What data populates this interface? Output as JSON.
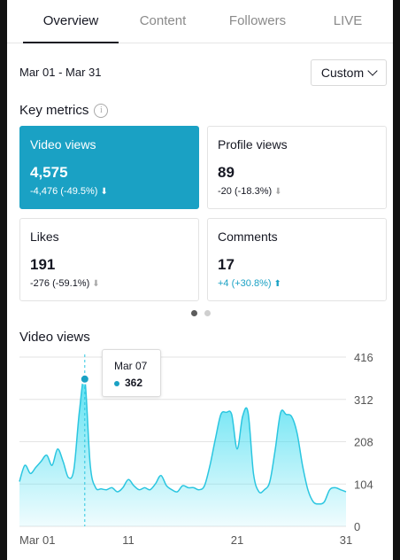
{
  "tabs": [
    {
      "label": "Overview",
      "active": true
    },
    {
      "label": "Content",
      "active": false
    },
    {
      "label": "Followers",
      "active": false
    },
    {
      "label": "LIVE",
      "active": false
    }
  ],
  "date_range": "Mar 01 - Mar 31",
  "range_button": {
    "label": "Custom",
    "icon": "chevron-down-icon"
  },
  "key_metrics": {
    "title": "Key metrics",
    "info_icon": "i",
    "cards": [
      {
        "label": "Video views",
        "value": "4,575",
        "change": "-4,476 (-49.5%)",
        "direction": "down",
        "selected": true
      },
      {
        "label": "Profile views",
        "value": "89",
        "change": "-20 (-18.3%)",
        "direction": "down",
        "selected": false
      },
      {
        "label": "Likes",
        "value": "191",
        "change": "-276 (-59.1%)",
        "direction": "down",
        "selected": false
      },
      {
        "label": "Comments",
        "value": "17",
        "change": "+4 (+30.8%)",
        "direction": "up",
        "selected": false
      }
    ]
  },
  "pager": {
    "pages": 2,
    "current": 1
  },
  "colors": {
    "accent": "#1aa1c4",
    "text": "#161823",
    "muted": "#8a8a8a"
  },
  "chart_data": {
    "type": "area",
    "title": "Video views",
    "x_ticks": [
      "Mar 01",
      "11",
      "21",
      "31"
    ],
    "y_ticks": [
      0,
      104,
      208,
      312,
      416
    ],
    "ylim": [
      0,
      416
    ],
    "xlim": [
      1,
      31
    ],
    "grid": true,
    "x": [
      1,
      1.5,
      2,
      2.5,
      3,
      3.5,
      4,
      4.5,
      5,
      5.5,
      6,
      6.5,
      7,
      7.5,
      8,
      8.5,
      9,
      9.5,
      10,
      10.5,
      11,
      11.5,
      12,
      12.5,
      13,
      13.5,
      14,
      14.5,
      15,
      15.5,
      16,
      16.5,
      17,
      17.5,
      18,
      18.5,
      19,
      19.5,
      20,
      20.5,
      21,
      21.5,
      22,
      22.5,
      23,
      23.5,
      24,
      24.5,
      25,
      25.5,
      26,
      26.5,
      27,
      27.5,
      28,
      28.5,
      29,
      29.5,
      30,
      30.5,
      31
    ],
    "y": [
      110,
      150,
      130,
      145,
      160,
      175,
      150,
      190,
      160,
      120,
      140,
      280,
      362,
      150,
      95,
      92,
      90,
      95,
      85,
      95,
      115,
      100,
      90,
      95,
      90,
      105,
      125,
      100,
      90,
      85,
      100,
      95,
      95,
      90,
      100,
      150,
      215,
      275,
      280,
      275,
      190,
      270,
      280,
      130,
      85,
      90,
      110,
      190,
      280,
      275,
      270,
      230,
      150,
      90,
      60,
      55,
      60,
      90,
      95,
      90,
      85
    ],
    "tooltip": {
      "date": "Mar 07",
      "value": "362",
      "x": 7
    }
  }
}
